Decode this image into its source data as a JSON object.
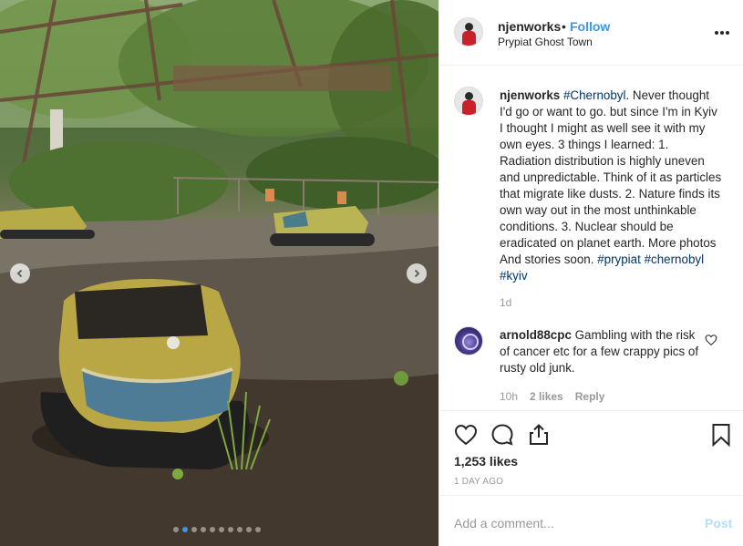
{
  "post": {
    "username": "njenworks",
    "separator": "•",
    "follow_label": "Follow",
    "location": "Prypiat Ghost Town",
    "more_icon": "more-horizontal-icon"
  },
  "caption": {
    "username": "njenworks",
    "hashtag_lead": "#Chernobyl",
    "body": ". Never thought I'd go or want to go. but since I'm in Kyiv I thought I might as well see it with my own eyes. 3 things I learned: 1. Radiation distribution is highly uneven and unpredictable. Think of it as particles that migrate like dusts. 2. Nature finds its own way out in the most unthinkable conditions. 3. Nuclear should be eradicated on planet earth. More photos And stories soon. ",
    "hashtags_end": [
      "#prypiat",
      "#chernobyl",
      "#kyiv"
    ],
    "time": "1d"
  },
  "comment": {
    "username": "arnold88cpc",
    "text": "Gambling with the risk of cancer etc for a few crappy pics of rusty old junk.",
    "time": "10h",
    "likes": "2 likes",
    "reply_label": "Reply"
  },
  "actions": {
    "likes": "1,253 likes",
    "date": "1 DAY AGO",
    "icons": [
      "heart-icon",
      "comment-icon",
      "share-icon",
      "bookmark-icon"
    ]
  },
  "add_comment": {
    "placeholder": "Add a comment...",
    "post_label": "Post"
  },
  "carousel": {
    "slide_count": 10,
    "active_index": 1
  },
  "colors": {
    "link_blue": "#3897f0",
    "hashtag": "#003569",
    "muted": "#999999",
    "post_disabled": "#b2dffc"
  }
}
